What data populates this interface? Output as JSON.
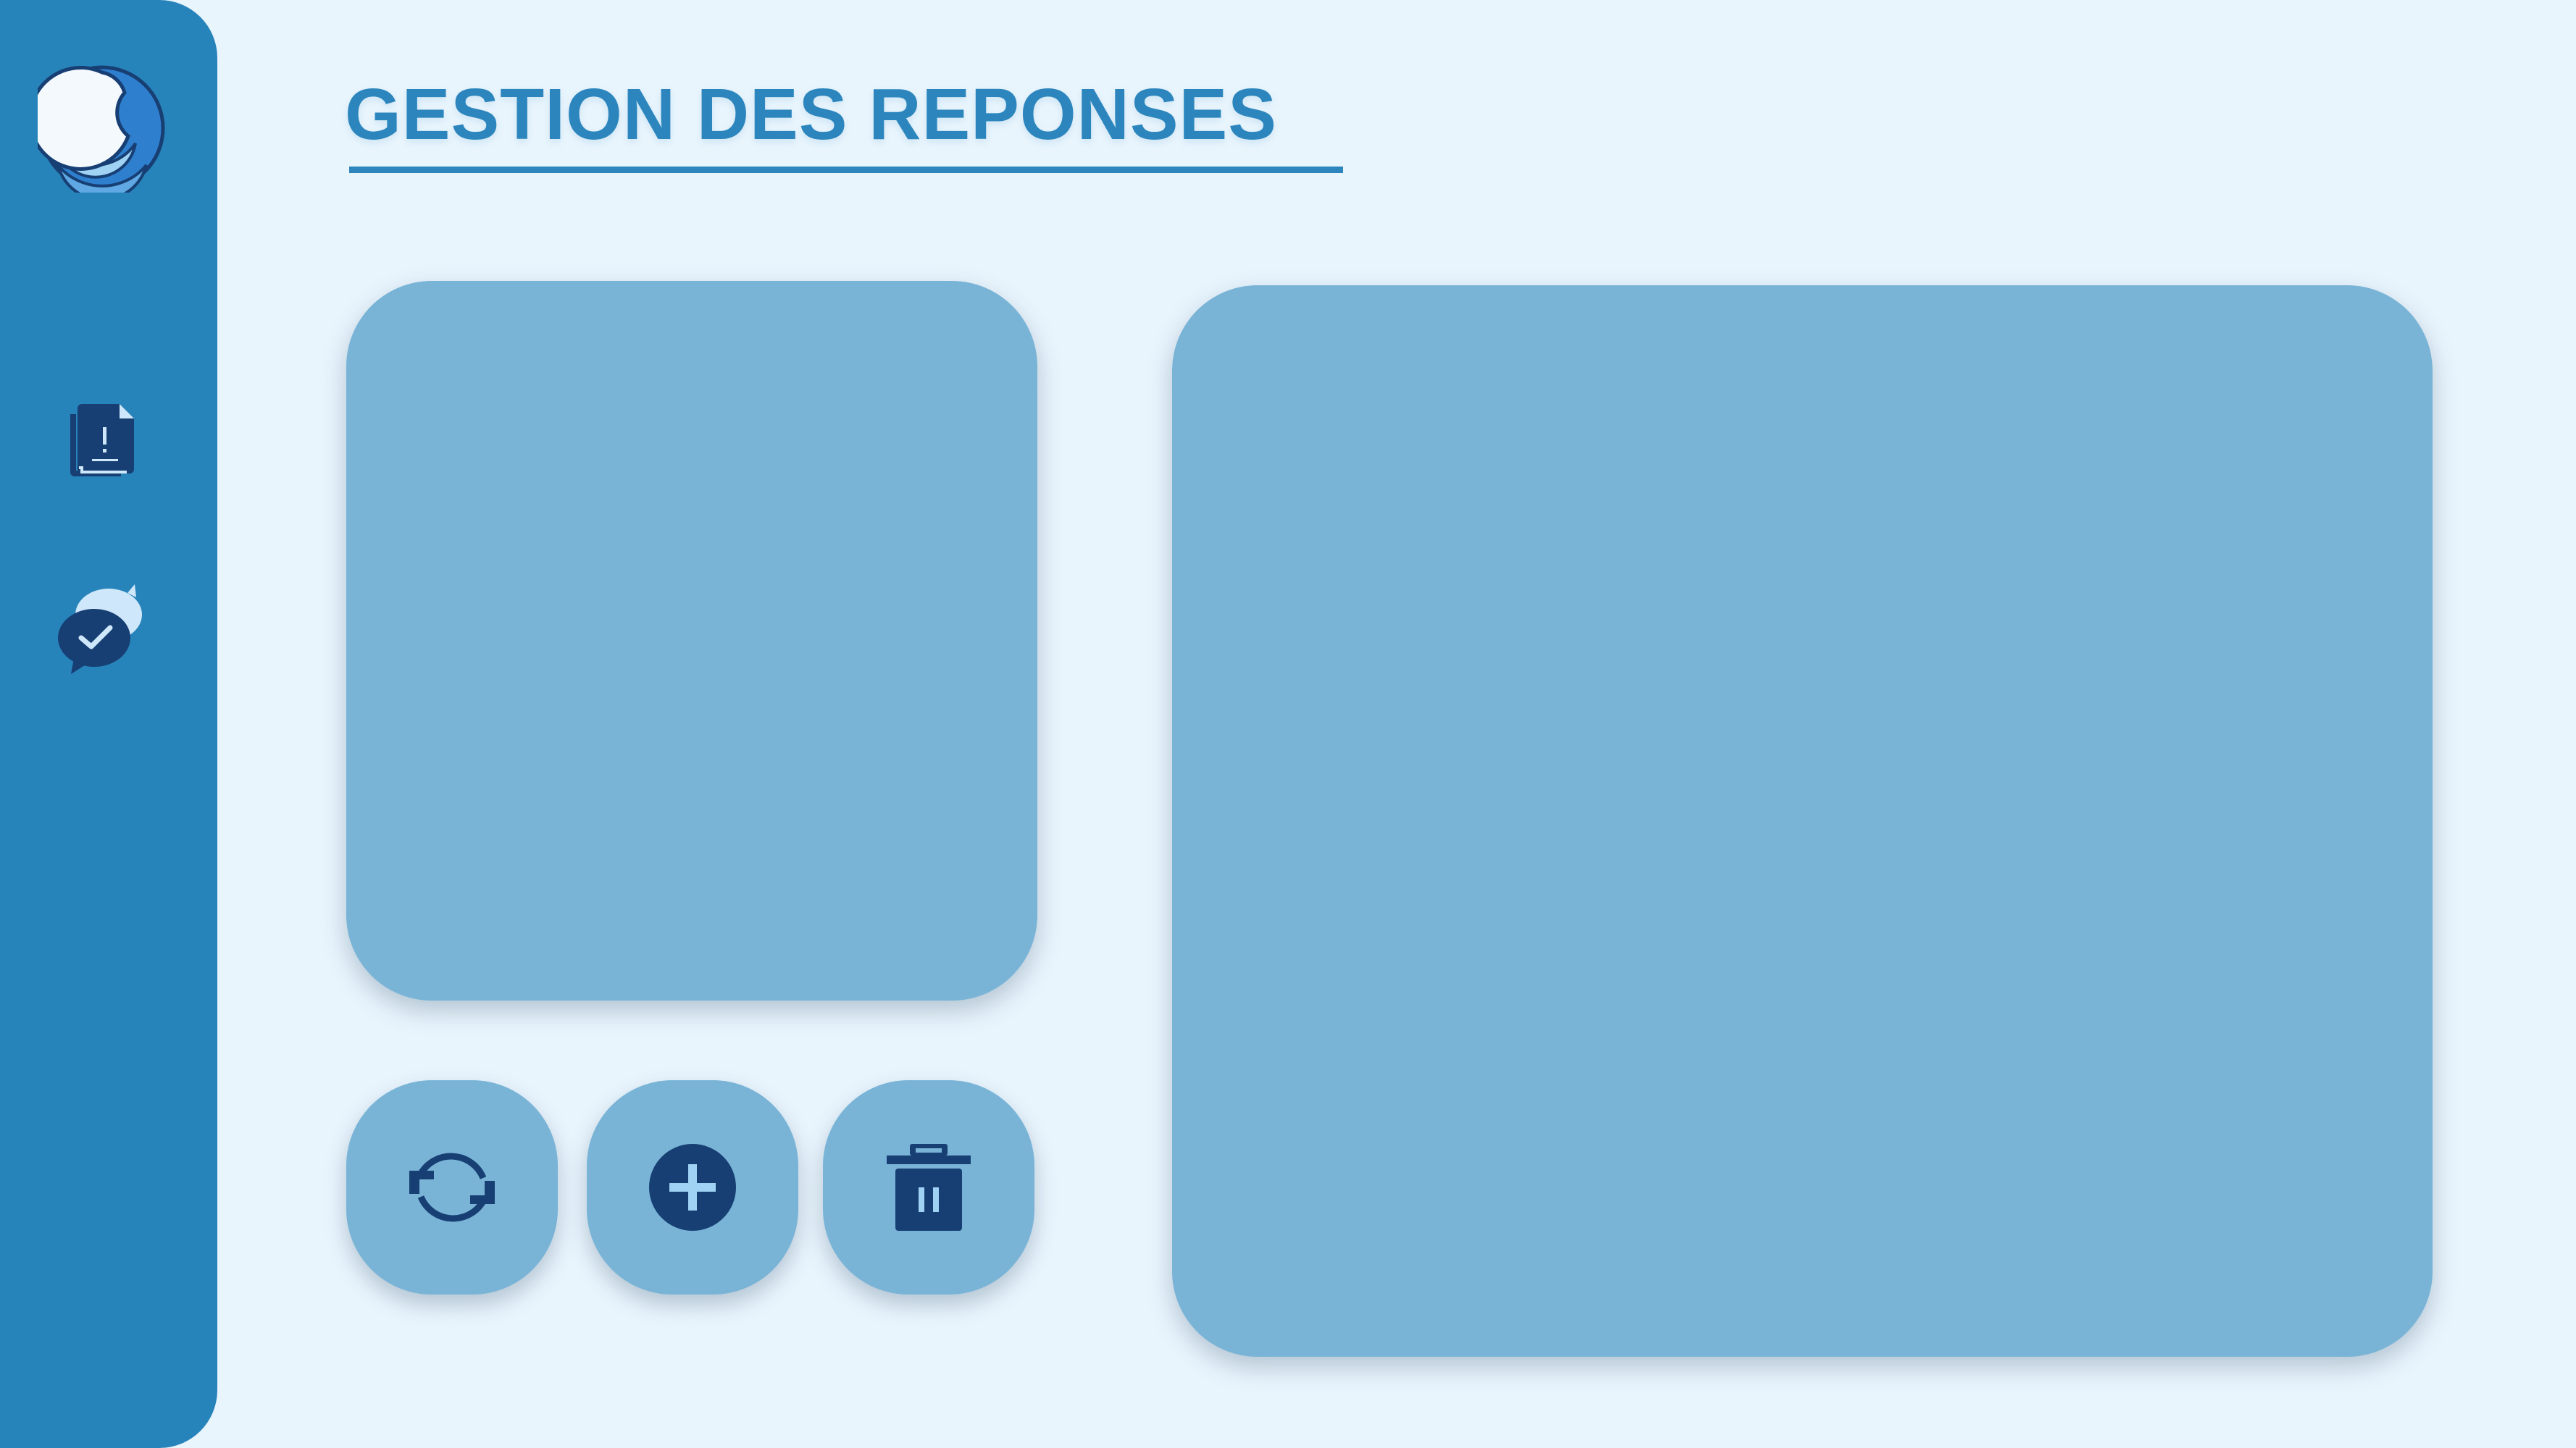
{
  "page": {
    "title": "GESTION DES REPONSES"
  },
  "sidebar": {
    "logo_icon": "logo-icon",
    "items": [
      {
        "id": "reports",
        "icon": "document-alert-icon"
      },
      {
        "id": "responses",
        "icon": "chat-check-icon"
      }
    ]
  },
  "actions": [
    {
      "id": "refresh",
      "icon": "refresh-icon"
    },
    {
      "id": "add",
      "icon": "plus-circle-icon"
    },
    {
      "id": "delete",
      "icon": "trash-icon"
    }
  ],
  "colors": {
    "sidebar": "#2784bb",
    "background": "#e9f5fd",
    "panel": "#79b4d7",
    "title": "#2c86bd",
    "icon_dark": "#173f73"
  }
}
